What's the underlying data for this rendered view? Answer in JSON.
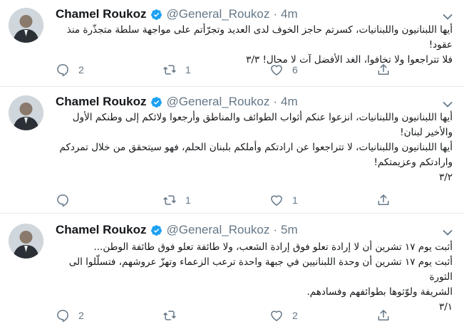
{
  "tweets": [
    {
      "name": "Chamel Roukoz",
      "handle": "@General_Roukoz",
      "dot": "·",
      "time": "4m",
      "lines": [
        "أيها اللبنانيون واللبنانيات، كسرتم حاجز الخوف لدى العديد وتجرّأتم على مواجهة سلطة متجذّرة منذ عقود!",
        "فلا تتراجعوا ولا تخافوا، الغد الأفضل آت لا محال! ٣/٣"
      ],
      "reply_count": "2",
      "retweet_count": "1",
      "like_count": "6"
    },
    {
      "name": "Chamel Roukoz",
      "handle": "@General_Roukoz",
      "dot": "·",
      "time": "4m",
      "lines": [
        "أيها اللبنانيون واللبنانيات، انزعوا عنكم أثواب الطوائف والمناطق وأرجعوا ولائكم إلى وطنكم الأول",
        "والأخير لبنان!",
        "أيها اللبنانيون واللبنانيات، لا تتراجعوا عن ارادتكم وأملكم بلبنان الحلم، فهو سيتحقق من خلال تمردكم",
        "وارادتكم وعزيمتكم!",
        "٣/٢"
      ],
      "reply_count": "",
      "retweet_count": "1",
      "like_count": "1"
    },
    {
      "name": "Chamel Roukoz",
      "handle": "@General_Roukoz",
      "dot": "·",
      "time": "5m",
      "lines": [
        "أثبت يوم ١٧ تشرين أن لا إرادة تعلو فوق إرادة الشعب، ولا طائفة تعلو فوق طائفة الوطن...",
        "أثبت يوم ١٧ تشرين أن وحدة اللبنانيين في جبهة واحدة ترعب الزعماء وتهزّ عروشهم، فتسلّلوا الى الثورة",
        "الشريفة ولوّثوها بطوائفهم وفسادهم.",
        "٣/١"
      ],
      "reply_count": "2",
      "retweet_count": "",
      "like_count": "2"
    }
  ],
  "colors": {
    "verified": "#1da1f2",
    "icon": "#657786",
    "divider": "#e6ecf0"
  },
  "icons": [
    "verified-badge-icon",
    "chevron-down-icon",
    "reply-icon",
    "retweet-icon",
    "like-icon",
    "share-icon"
  ]
}
